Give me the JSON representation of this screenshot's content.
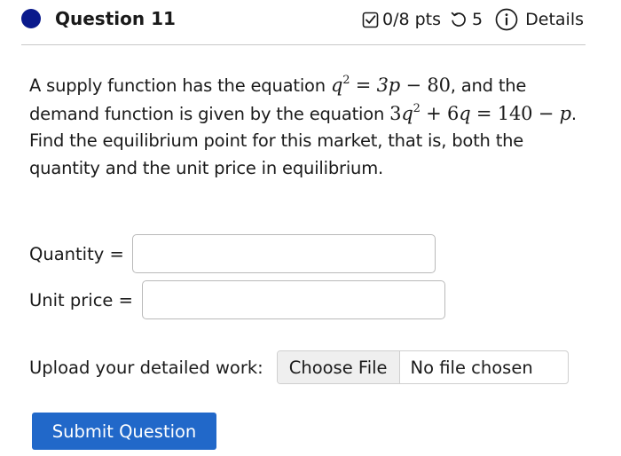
{
  "header": {
    "title": "Question 11",
    "points": "0/8 pts",
    "tries": "5",
    "details": "Details",
    "status_color": "#0a1a8c"
  },
  "question": {
    "p1_a": "A supply function has the equation ",
    "eq1": "q² = 3p − 80",
    "p1_b": ", and the demand function is given by the equation ",
    "eq2": "3q² + 6q = 140 − p",
    "p1_c": ". Find the equilibrium point for this market, that is, both the quantity and the unit price in equilibrium."
  },
  "fields": {
    "quantity_label": "Quantity =",
    "quantity_value": "",
    "price_label": "Unit price =",
    "price_value": ""
  },
  "upload": {
    "label": "Upload your detailed work:",
    "button": "Choose File",
    "status": "No file chosen"
  },
  "submit": {
    "label": "Submit Question",
    "color": "#2168c9"
  },
  "icons": {
    "points": "checkbox-icon",
    "retry": "retry-icon",
    "info": "info-icon"
  }
}
